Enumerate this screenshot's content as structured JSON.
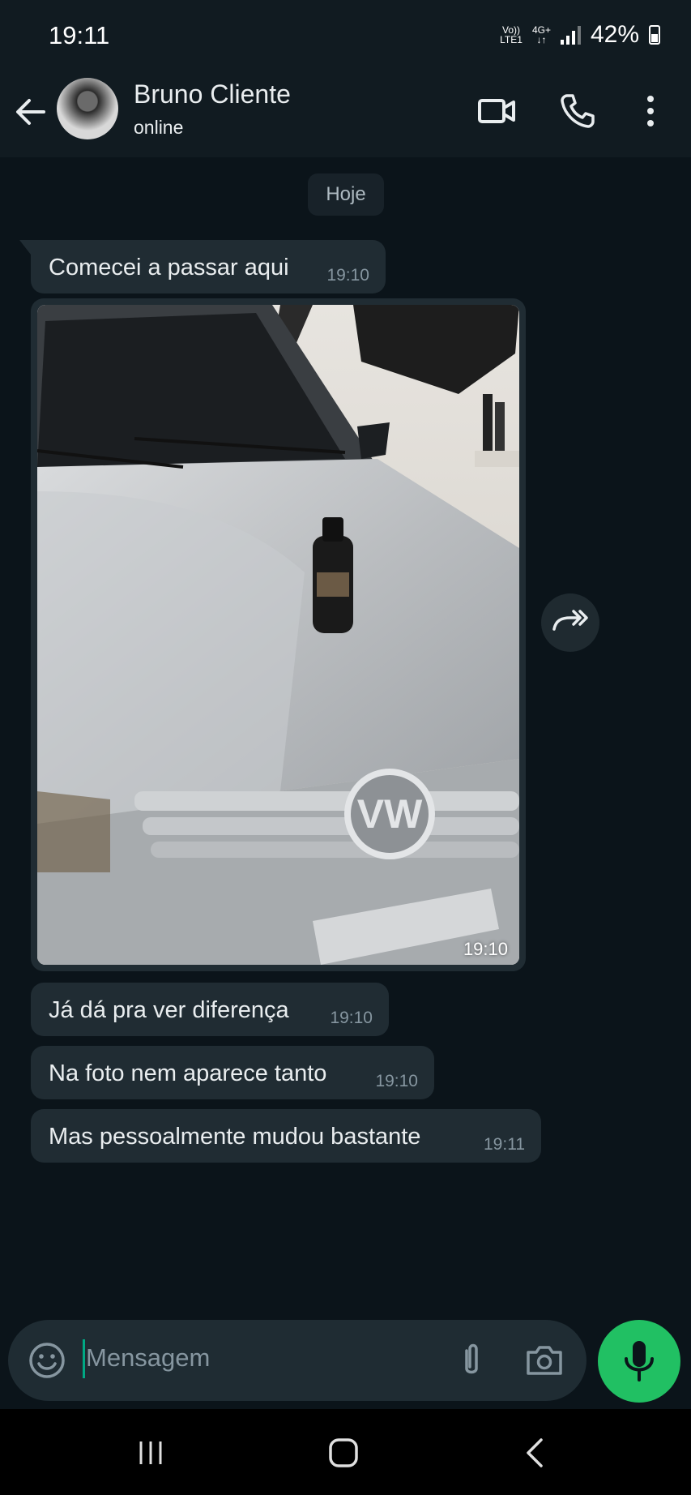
{
  "status_bar": {
    "time": "19:11",
    "volte_top": "Vo))",
    "volte_bottom": "LTE1",
    "network_top": "4G+",
    "network_bottom": "↓↑",
    "battery": "42%"
  },
  "header": {
    "contact_name": "Bruno Cliente",
    "contact_status": "online",
    "icons": [
      "back-arrow-icon",
      "video-call-icon",
      "phone-icon",
      "more-vert-icon"
    ]
  },
  "chat": {
    "date_chip": "Hoje",
    "messages": [
      {
        "text": "Comecei a passar aqui",
        "time": "19:10"
      },
      {
        "type": "image",
        "time": "19:10"
      },
      {
        "text": "Já dá pra ver diferença",
        "time": "19:10"
      },
      {
        "text": "Na foto nem aparece tanto",
        "time": "19:10"
      },
      {
        "text": "Mas pessoalmente mudou bastante",
        "time": "19:11"
      }
    ]
  },
  "composer": {
    "placeholder": "Mensagem",
    "icons": [
      "emoji-icon",
      "attach-icon",
      "camera-icon",
      "mic-icon"
    ]
  },
  "colors": {
    "background": "#0b141a",
    "header": "#111b21",
    "bubble": "#202c33",
    "accent": "#21c063",
    "muted_text": "#8696a0"
  }
}
